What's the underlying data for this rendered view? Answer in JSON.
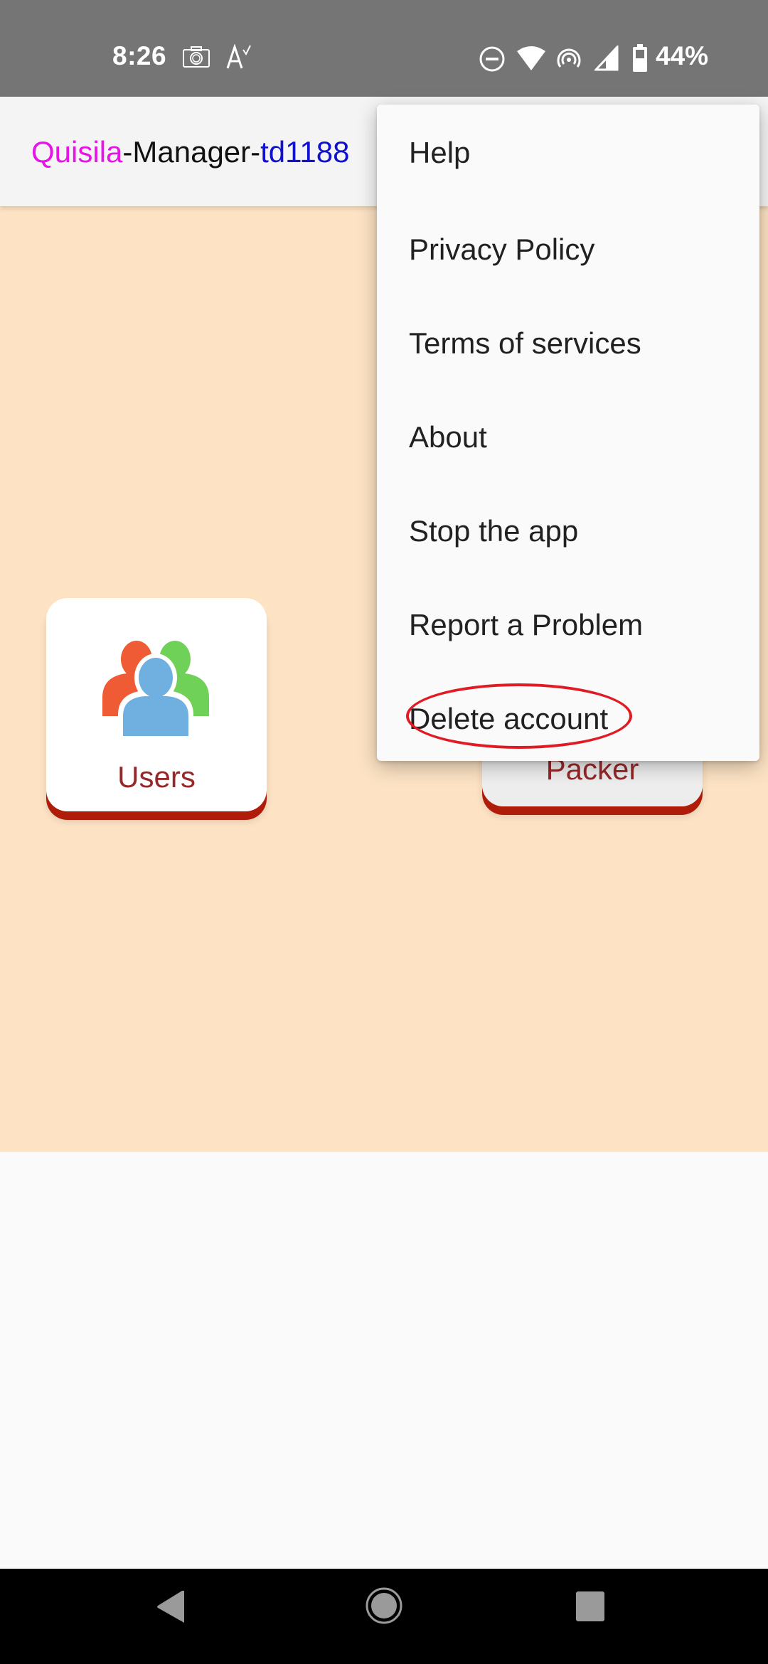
{
  "status_bar": {
    "time": "8:26",
    "left_icons": [
      "camera-icon",
      "spellcheck-icon"
    ],
    "right_icons": [
      "do-not-disturb-icon",
      "wifi-icon",
      "hotspot-icon",
      "cell-signal-icon",
      "battery-icon"
    ],
    "battery_percent": "44%"
  },
  "app_bar": {
    "title_parts": {
      "brand": "Quisila",
      "middle": "-Manager-",
      "code": "td1188"
    },
    "colors": {
      "brand": "#e713e7",
      "middle": "#111111",
      "code": "#1010d0"
    }
  },
  "tiles": [
    {
      "label": "Users",
      "icon": "users-group-icon"
    },
    {
      "label": "Packer"
    }
  ],
  "overflow_menu": {
    "items": [
      {
        "label": "Help"
      },
      {
        "label": "Privacy Policy"
      },
      {
        "label": "Terms of services"
      },
      {
        "label": "About"
      },
      {
        "label": "Stop the app"
      },
      {
        "label": "Report a Problem"
      },
      {
        "label": "Delete account",
        "annotated": true
      }
    ],
    "annotation_color": "#e01b24"
  },
  "nav_bar": {
    "buttons": [
      "back-icon",
      "home-icon",
      "recents-icon"
    ]
  },
  "theme": {
    "content_bg": "#fde3c4",
    "tile_shadow": "#b01c0a",
    "tile_label": "#96282a"
  }
}
